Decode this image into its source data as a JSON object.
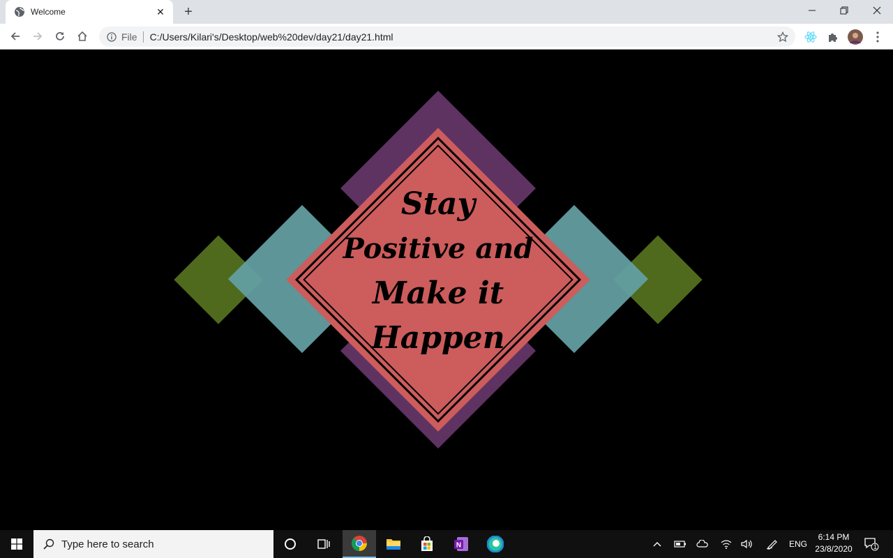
{
  "browser": {
    "tab_title": "Welcome",
    "address_scheme": "File",
    "address_url": "C:/Users/Kilari's/Desktop/web%20dev/day21/day21.html"
  },
  "page": {
    "background": "#000000",
    "quote_lines": [
      "Stay",
      "Positive and",
      "Make it",
      "Happen"
    ],
    "colors": {
      "purple": "#5e3362",
      "teal": "#64a0a4",
      "green": "#4f6a1d",
      "coral": "#cd5c5c"
    }
  },
  "taskbar": {
    "search_placeholder": "Type here to search",
    "language": "ENG",
    "time": "6:14 PM",
    "date": "23/8/2020",
    "notification_count": "1",
    "pinned_apps": [
      "chrome-icon",
      "file-explorer-icon",
      "store-icon",
      "onenote-icon",
      "edge-icon"
    ]
  }
}
